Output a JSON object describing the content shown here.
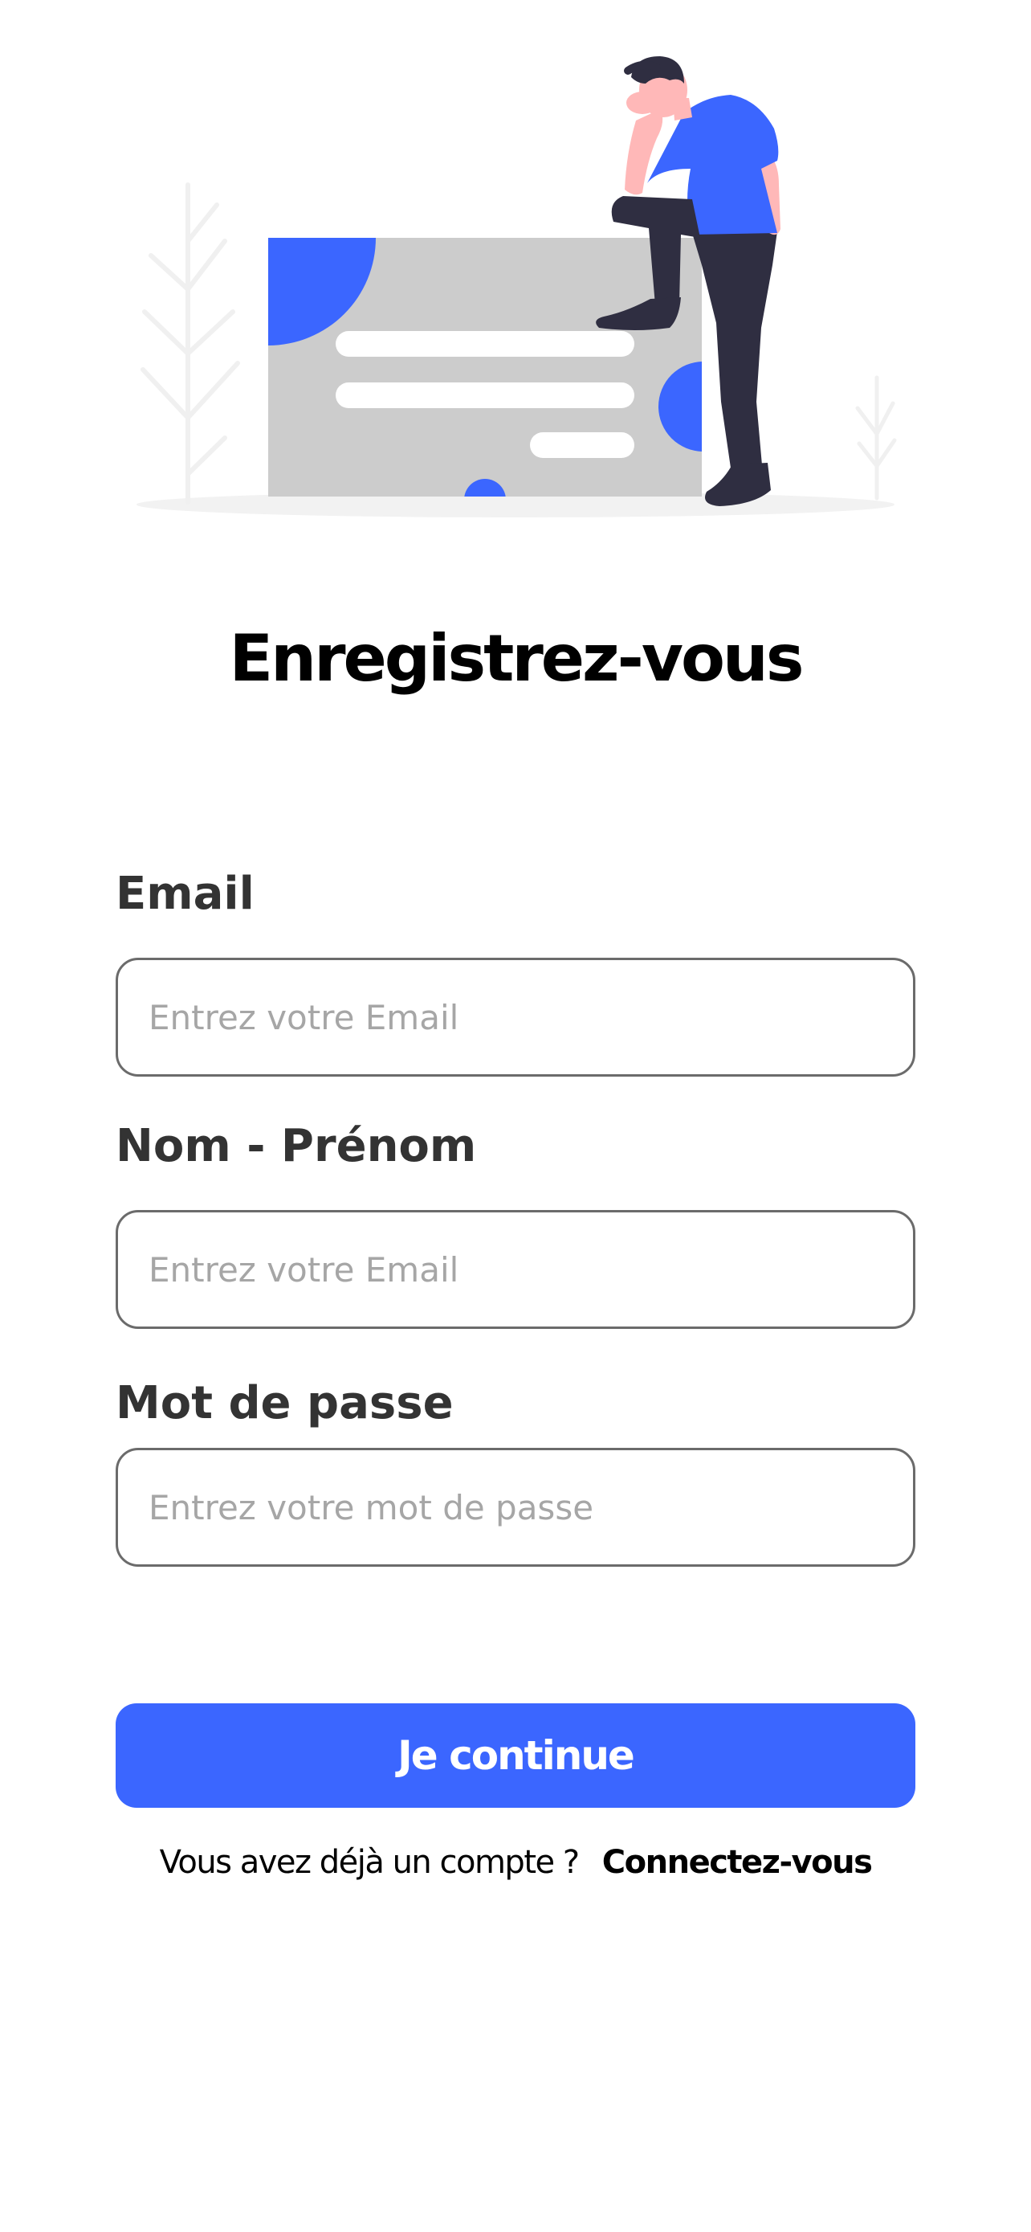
{
  "page": {
    "title": "Enregistrez-vous"
  },
  "form": {
    "email": {
      "label": "Email",
      "placeholder": "Entrez votre Email",
      "value": ""
    },
    "name": {
      "label": "Nom - Prénom",
      "placeholder": "Entrez votre Email",
      "value": ""
    },
    "password": {
      "label": "Mot de passe",
      "placeholder": "Entrez votre mot de passe",
      "value": ""
    },
    "submit_label": "Je continue"
  },
  "footer": {
    "prompt": "Vous avez déjà un compte ?",
    "link_label": "Connectez-vous"
  },
  "colors": {
    "accent": "#3b66ff",
    "card": "#cccccc",
    "figure_dark": "#2f2e41",
    "skin": "#ffb8b8",
    "ground": "#f2f2f2",
    "label_text": "#333333",
    "placeholder": "#a6a6a6",
    "input_border": "#6b6b6b"
  },
  "illustration": {
    "name": "person-thinking-at-document-illustration"
  }
}
